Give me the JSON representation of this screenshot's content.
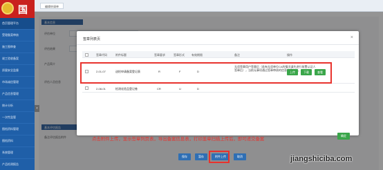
{
  "header": {
    "logo_char": "国",
    "tab_label": "编辑申请单"
  },
  "sidebar": {
    "items": [
      {
        "label": "首页管理平台"
      },
      {
        "label": "受理备案审核"
      },
      {
        "label": "施工图审查"
      },
      {
        "label": "竣工验收备案"
      },
      {
        "label": "质量安全监督"
      },
      {
        "label": "市场诚信管理"
      },
      {
        "label": "产品信息管理"
      },
      {
        "label": "统计分析"
      },
      {
        "label": "一次性监管"
      },
      {
        "label": "图档资料管理"
      },
      {
        "label": "图档资料"
      },
      {
        "label": "系统管理"
      },
      {
        "label": "产品检测报告"
      },
      {
        "label": "产品许可备案"
      },
      {
        "label": "产品质量管理"
      }
    ]
  },
  "background_form": {
    "section1": "基本信息",
    "labels": [
      "评估单位",
      "评估结果",
      "产品简介"
    ],
    "section2": "评估人员信息",
    "section3": "基本评估报告",
    "attach_label": "备注评估报告附件"
  },
  "bottom_buttons": [
    "保存",
    "暂存",
    "附件上传",
    "取消"
  ],
  "modal": {
    "title": "签章列表页",
    "close": "×",
    "columns": [
      "",
      "签章代码",
      "附件标题",
      "签章要求",
      "签章形式",
      "有效期限",
      "备注",
      "操作"
    ],
    "rows": [
      {
        "code": "2-01-07",
        "title": "送检申请备案登记表",
        "req": "R",
        "form": "F",
        "valid": "D",
        "remark": "无须签章用户签章后（若有无须单位CA的情况请先进行前置认证人签章后），当前无事项通过签章审核的信息后续审核。",
        "ops": [
          "上传",
          "下载",
          "查看"
        ]
      },
      {
        "code": "2-08-01",
        "title": "检测化验品登记卷",
        "req": "CR",
        "form": "U",
        "valid": "D",
        "remark": "",
        "ops": []
      }
    ],
    "confirm": "确定"
  },
  "annotation": "点击附件上传，显示签章列页表，导出备案信息表，打印盖章扫描上传后，即可递交备案",
  "watermark": "jiangshiciba.com",
  "colors": {
    "sidebar": "#1f5fa8",
    "highlight": "#e8322d",
    "action_green": "#3aa64a",
    "primary_blue": "#2f6fb4"
  }
}
